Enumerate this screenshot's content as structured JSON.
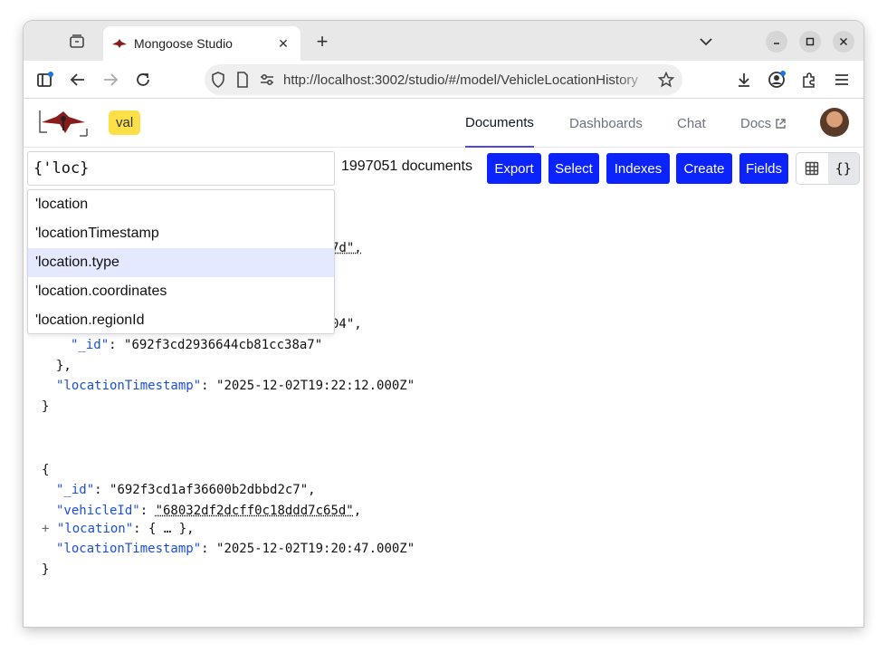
{
  "browser": {
    "tab_title": "Mongoose Studio",
    "url": "http://localhost:3002/studio/#/model/VehicleLocationHistory"
  },
  "app": {
    "badge": "val",
    "nav": [
      {
        "label": "Documents"
      },
      {
        "label": "Dashboards"
      },
      {
        "label": "Chat"
      },
      {
        "label": "Docs"
      }
    ]
  },
  "search": {
    "value": "{'loc}",
    "doc_count": "1997051 documents"
  },
  "actions": {
    "export": "Export",
    "select": "Select",
    "indexes": "Indexes",
    "create": "Create",
    "fields": "Fields",
    "json_view": "{}"
  },
  "autocomplete": [
    "'location",
    "'locationTimestamp",
    "'location.type",
    "'location.coordinates",
    "'location.regionId"
  ],
  "doc1": {
    "frag_vehicle": "7d\",",
    "frag_region": "04\",",
    "id_key": "\"_id\"",
    "id_val": "\"692f3cd2936644cb81cc38a7\"",
    "close_obj": "},",
    "ts_key": "\"locationTimestamp\"",
    "ts_val": "\"2025-12-02T19:22:12.000Z\"",
    "close": "}"
  },
  "doc2": {
    "open": "{",
    "id_key": "\"_id\"",
    "id_val": "\"692f3cd1af36600b2dbbd2c7\",",
    "vehicle_key": "\"vehicleId\"",
    "vehicle_val": "\"68032df2dcff0c18ddd7c65d\"",
    "location_key": "\"location\"",
    "location_val": "{ … },",
    "ts_key": "\"locationTimestamp\"",
    "ts_val": "\"2025-12-02T19:20:47.000Z\"",
    "close": "}"
  }
}
